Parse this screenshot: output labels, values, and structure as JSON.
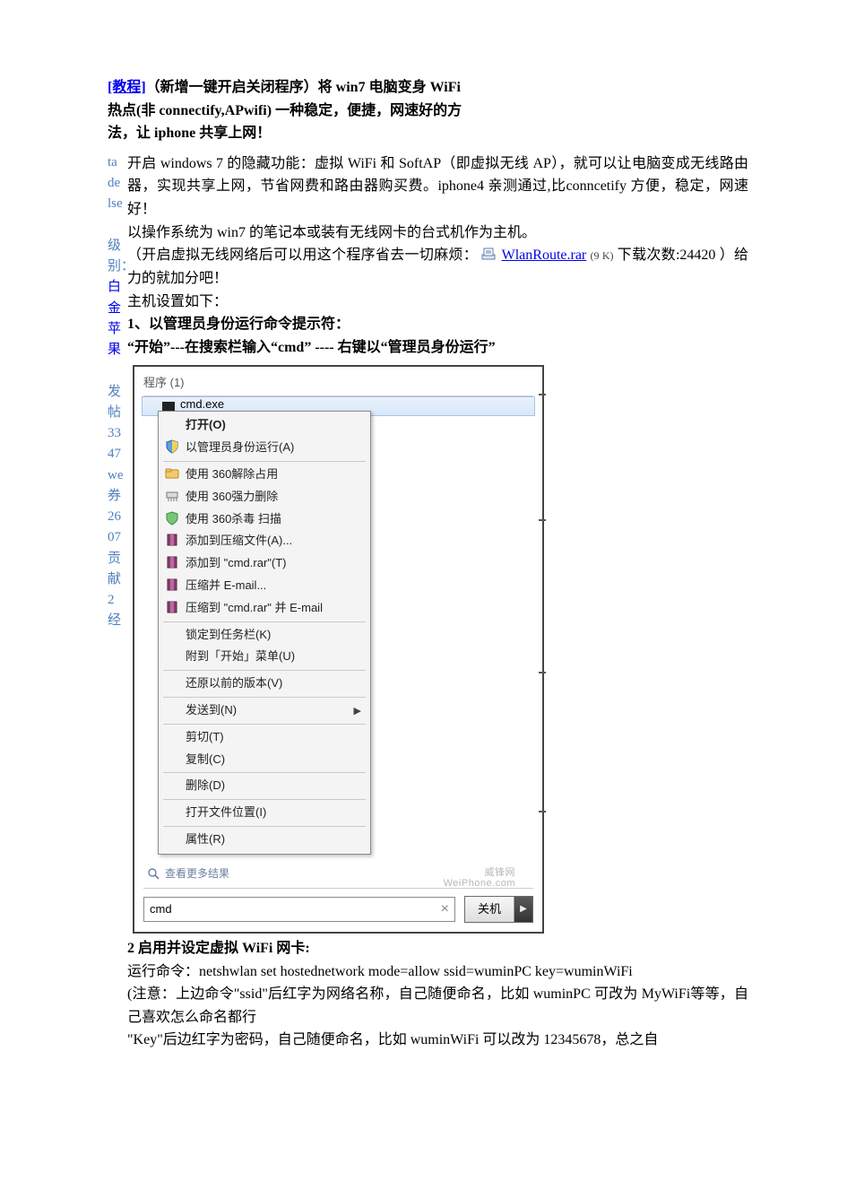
{
  "title": {
    "link": "[教程]",
    "rest1": "（新增一键开启关闭程序）将 win7 电脑变身 WiFi",
    "line2": "热点(非 connectify,APwifi)  一种稳定，便捷，网速好的方",
    "line3": "法，让 iphone 共享上网！"
  },
  "sidebar": {
    "name_chars": "tadelse",
    "level_label": "级别：",
    "level_value": "白金苹果",
    "posts_label": "发帖",
    "posts_value": "3347",
    "coupon_label": "we券",
    "coupon_value": "2607",
    "contrib_label": "贡献",
    "contrib_value": "2",
    "exp_label": "经"
  },
  "body": {
    "p1a": "开启 windows 7 的隐藏功能：虚拟 WiFi 和 SoftAP（即虚拟无线 AP），就可以让电脑变成无线路由器，实现共享上网，节省网费和路由器购买费。iphone4  亲测通过,比conncetify 方便，稳定，网速好！",
    "p2": "以操作系统为 win7 的笔记本或装有无线网卡的台式机作为主机。",
    "p3_pre": "（开启虚拟无线网络后可以用这个程序省去一切麻烦：",
    "p3_link": "WlanRoute.rar",
    "p3_size": "(9  K)",
    "p3_post": "下载次数:24420 ）给力的就加分吧！",
    "p4": "主机设置如下：",
    "step1_title": "1、以管理员身份运行命令提示符：",
    "step1_desc": "“开始”---在搜索栏输入“cmd” ---- 右键以“管理员身份运行”",
    "step2_title": "2 启用并设定虚拟 WiFi  网卡:",
    "step2_cmd": "运行命令：netshwlan set hostednetwork mode=allow ssid=wuminPC key=wuminWiFi",
    "step2_note1": "(注意：上边命令\"ssid\"后红字为网络名称，自己随便命名，比如 wuminPC 可改为 MyWiFi等等，自己喜欢怎么命名都行",
    "step2_note2": "\"Key\"后边红字为密码，自己随便命名，比如 wuminWiFi 可以改为 12345678，总之自"
  },
  "screenshot": {
    "programs_heading": "程序 (1)",
    "file_name": "cmd.exe",
    "menu": {
      "open": "打开(O)",
      "run_admin": "以管理员身份运行(A)",
      "unlock_360": "使用 360解除占用",
      "force_del_360": "使用 360强力删除",
      "scan_360": "使用 360杀毒 扫描",
      "add_archive": "添加到压缩文件(A)...",
      "add_cmd_rar": "添加到 \"cmd.rar\"(T)",
      "compress_email": "压缩并 E-mail...",
      "compress_cmd_email": "压缩到 \"cmd.rar\" 并 E-mail",
      "pin_taskbar": "锁定到任务栏(K)",
      "pin_start": "附到「开始」菜单(U)",
      "restore_prev": "还原以前的版本(V)",
      "send_to": "发送到(N)",
      "cut": "剪切(T)",
      "copy": "复制(C)",
      "delete": "删除(D)",
      "open_location": "打开文件位置(I)",
      "properties": "属性(R)"
    },
    "see_more": "查看更多结果",
    "searchbox_value": "cmd",
    "shutdown": "关机",
    "watermark_top": "威锋网",
    "watermark_bottom": "WeiPhone.com"
  }
}
